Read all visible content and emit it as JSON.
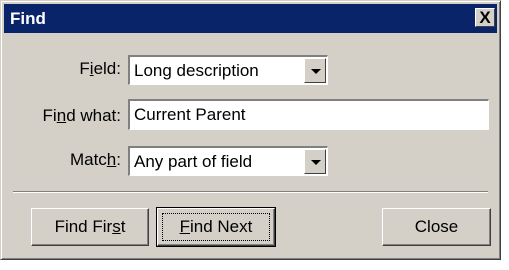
{
  "window": {
    "title": "Find",
    "close_glyph": "X"
  },
  "form": {
    "field_label_pre": "F",
    "field_label_ul": "i",
    "field_label_post": "eld:",
    "field_value": "Long description",
    "find_label_pre": "Fi",
    "find_label_ul": "n",
    "find_label_post": "d what:",
    "find_value": "Current Parent",
    "match_label_pre": "Matc",
    "match_label_ul": "h",
    "match_label_post": ":",
    "match_value": "Any part of field"
  },
  "buttons": {
    "find_first_pre": "Find Fir",
    "find_first_ul": "s",
    "find_first_post": "t",
    "find_next_ul": "F",
    "find_next_post": "ind Next",
    "close": "Close"
  },
  "icons": {
    "dropdown": "triangle-down",
    "close": "x"
  },
  "colors": {
    "titlebar": "#0a246a",
    "face": "#d4d0c8"
  }
}
